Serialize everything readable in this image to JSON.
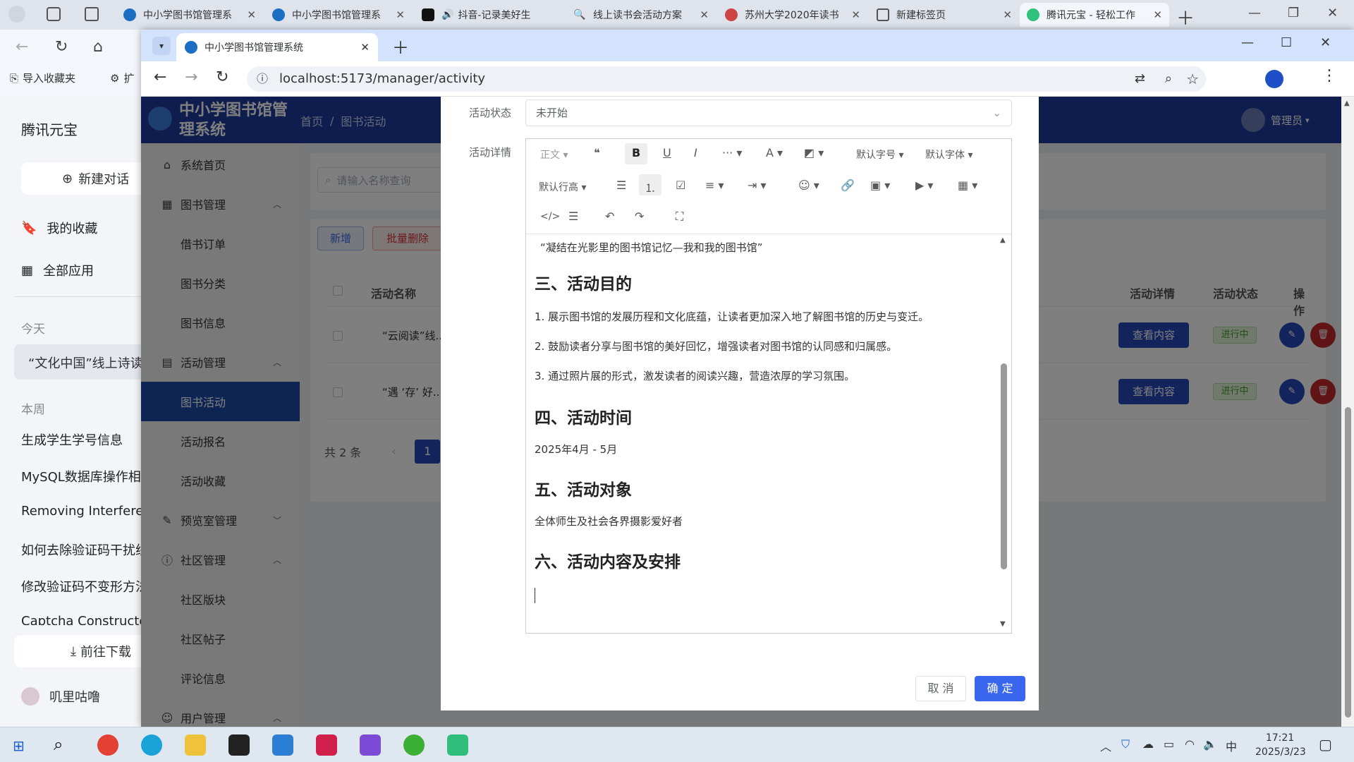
{
  "outer_tabs": [
    {
      "label": "中小学图书馆管理系"
    },
    {
      "label": "中小学图书馆管理系"
    },
    {
      "label": "抖音-记录美好生"
    },
    {
      "label": "线上读书会活动方案"
    },
    {
      "label": "苏州大学2020年读书"
    },
    {
      "label": "新建标签页"
    },
    {
      "label": "腾讯元宝 - 轻松工作"
    }
  ],
  "outer_bookmarks": {
    "import": "导入收藏夹",
    "ext": "扩"
  },
  "yuanbao": {
    "title": "腾讯元宝",
    "new_chat": "新建对话",
    "favorites": "我的收藏",
    "all_apps": "全部应用",
    "today": "今天",
    "today_item": "“文化中国”线上诗读",
    "week": "本周",
    "week_items": [
      "生成学生学号信息",
      "MySQL数据库操作相关",
      "Removing Interferen",
      "如何去除验证码干扰线",
      "修改验证码不变形方法",
      "Captcha Constructor"
    ],
    "download": "前往下载",
    "user": "叽里咕噜"
  },
  "inner_tab": {
    "label": "中小学图书馆管理系统",
    "url": "localhost:5173/manager/activity"
  },
  "app": {
    "brand": "中小学图书馆管理系统",
    "breadcrumb_home": "首页",
    "breadcrumb_sep": "/",
    "breadcrumb_current": "图书活动",
    "admin": "管理员",
    "menu": [
      {
        "label": "系统首页"
      },
      {
        "label": "图书管理"
      },
      {
        "label": "借书订单"
      },
      {
        "label": "图书分类"
      },
      {
        "label": "图书信息"
      },
      {
        "label": "活动管理"
      },
      {
        "label": "图书活动"
      },
      {
        "label": "活动报名"
      },
      {
        "label": "活动收藏"
      },
      {
        "label": "预览室管理"
      },
      {
        "label": "社区管理"
      },
      {
        "label": "社区版块"
      },
      {
        "label": "社区帖子"
      },
      {
        "label": "评论信息"
      },
      {
        "label": "用户管理"
      }
    ],
    "search_placeholder": "请输入名称查询",
    "add_btn": "新增",
    "batch_delete": "批量删除",
    "table_headers": {
      "name": "活动名称",
      "detail": "活动详情",
      "status": "活动状态",
      "ops": "操作"
    },
    "rows": [
      {
        "name": "“云阅读”线...",
        "detail_btn": "查看内容",
        "status": "进行中"
      },
      {
        "name": "“遇 ‘存’ 好...",
        "detail_btn": "查看内容",
        "status": "进行中"
      }
    ],
    "total": "共 2 条",
    "page": "1"
  },
  "dialog": {
    "status_label": "活动状态",
    "status_value": "未开始",
    "detail_label": "活动详情",
    "toolbar": {
      "paragraph": "正文",
      "font_size": "默认字号",
      "font_family": "默认字体",
      "line_height": "默认行高"
    },
    "content": {
      "quote": "“凝结在光影里的图书馆记忆—我和我的图书馆”",
      "h_goal": "三、活动目的",
      "goals": [
        "1. 展示图书馆的发展历程和文化底蕴，让读者更加深入地了解图书馆的历史与变迁。",
        "2. 鼓励读者分享与图书馆的美好回忆，增强读者对图书馆的认同感和归属感。",
        "3. 通过照片展的形式，激发读者的阅读兴趣，营造浓厚的学习氛围。"
      ],
      "h_time": "四、活动时间",
      "time": "2025年4月 - 5月",
      "h_target": "五、活动对象",
      "target": "全体师生及社会各界摄影爱好者",
      "h_arrange": "六、活动内容及安排"
    },
    "cancel": "取 消",
    "ok": "确 定"
  },
  "taskbar": {
    "time": "17:21",
    "date": "2025/3/23",
    "ime": "中"
  },
  "colors": {
    "primary": "#1c3b9c",
    "accent": "#3a66ee",
    "danger": "#d63031",
    "success": "#67c23a"
  }
}
